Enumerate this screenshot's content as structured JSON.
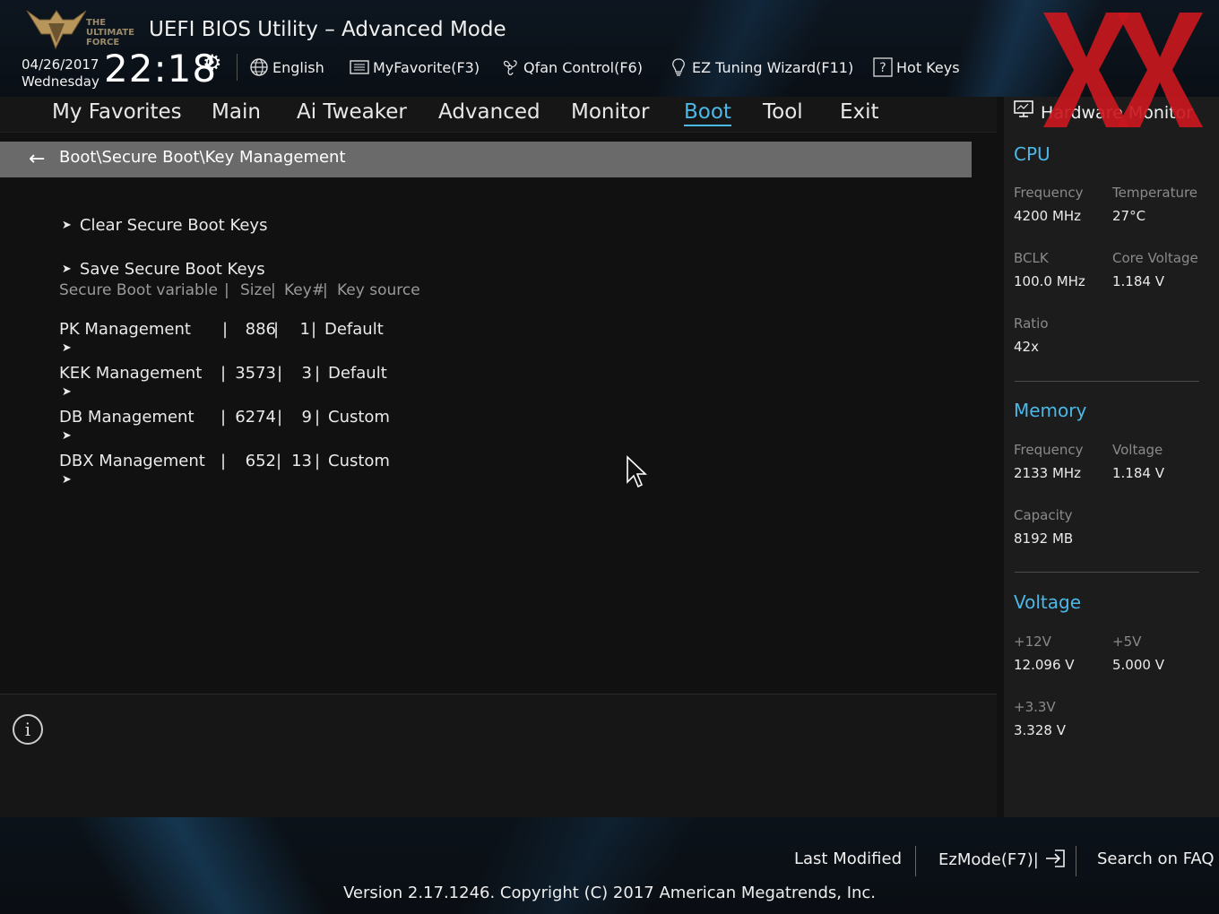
{
  "header": {
    "app_title": "UEFI BIOS Utility – Advanced Mode",
    "logo_text": [
      "THE",
      "ULTIMATE",
      "FORCE"
    ],
    "date": "04/26/2017",
    "weekday": "Wednesday",
    "time": "22:18",
    "toolbar": {
      "language": "English",
      "favorite": "MyFavorite(F3)",
      "qfan": "Qfan Control(F6)",
      "ez_tuning": "EZ Tuning Wizard(F11)",
      "hot_keys": "Hot Keys"
    }
  },
  "menu": {
    "items": [
      "My Favorites",
      "Main",
      "Ai Tweaker",
      "Advanced",
      "Monitor",
      "Boot",
      "Tool",
      "Exit"
    ],
    "active": "Boot"
  },
  "breadcrumb": "Boot\\Secure Boot\\Key Management",
  "actions": [
    "Clear Secure Boot Keys",
    "Save Secure Boot Keys"
  ],
  "table": {
    "headers": [
      "Secure Boot variable",
      "Size",
      "Key#",
      "Key source"
    ],
    "rows": [
      {
        "name": "PK Management",
        "size": "886",
        "keys": "1",
        "source": "Default"
      },
      {
        "name": "KEK Management",
        "size": "3573",
        "keys": "3",
        "source": "Default"
      },
      {
        "name": "DB Management",
        "size": "6274",
        "keys": "9",
        "source": "Custom"
      },
      {
        "name": "DBX Management",
        "size": "652",
        "keys": "13",
        "source": "Custom"
      }
    ]
  },
  "hardware_monitor": {
    "title": "Hardware Monitor",
    "cpu": {
      "label": "CPU",
      "frequency_label": "Frequency",
      "frequency": "4200 MHz",
      "temperature_label": "Temperature",
      "temperature": "27°C",
      "bclk_label": "BCLK",
      "bclk": "100.0 MHz",
      "core_voltage_label": "Core Voltage",
      "core_voltage": "1.184 V",
      "ratio_label": "Ratio",
      "ratio": "42x"
    },
    "memory": {
      "label": "Memory",
      "frequency_label": "Frequency",
      "frequency": "2133 MHz",
      "voltage_label": "Voltage",
      "voltage": "1.184 V",
      "capacity_label": "Capacity",
      "capacity": "8192 MB"
    },
    "voltage": {
      "label": "Voltage",
      "v12_label": "+12V",
      "v12": "12.096 V",
      "v5_label": "+5V",
      "v5": "5.000 V",
      "v33_label": "+3.3V",
      "v33": "3.328 V"
    }
  },
  "footer": {
    "last_modified": "Last Modified",
    "ezmode": "EzMode(F7)|",
    "search": "Search on FAQ",
    "copyright": "Version 2.17.1246. Copyright (C) 2017 American Megatrends, Inc."
  },
  "colors": {
    "accent": "#4bb8e8",
    "breadcrumb_bg": "#6a6a6a",
    "watermark": "#c8181e"
  },
  "icons": [
    "globe-icon",
    "favorite-list-icon",
    "fan-icon",
    "lightbulb-icon",
    "help-icon",
    "gear-icon",
    "back-arrow-icon",
    "info-icon",
    "monitor-icon",
    "exit-icon",
    "mouse-cursor-icon"
  ]
}
